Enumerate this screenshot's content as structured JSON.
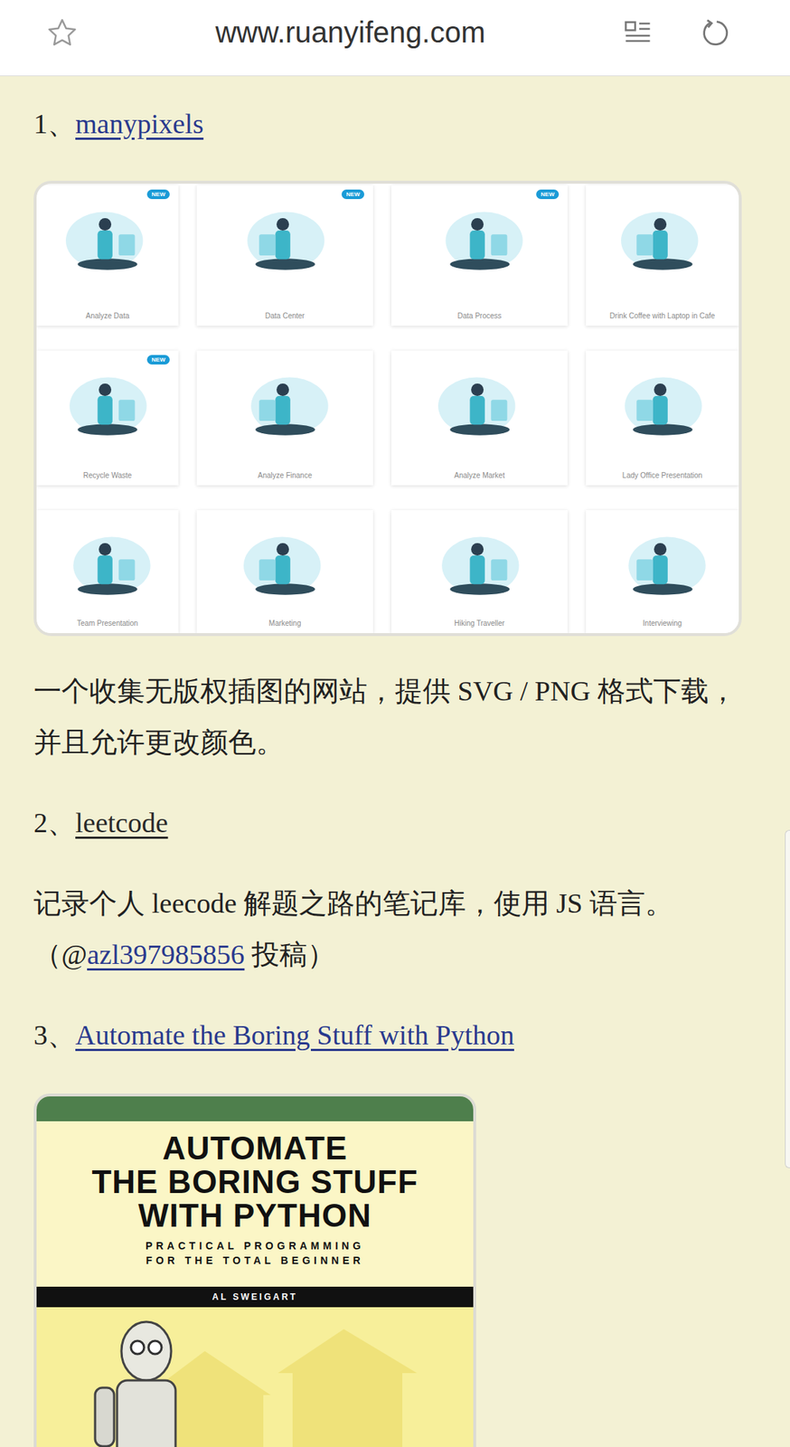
{
  "browser": {
    "url": "www.ruanyifeng.com",
    "bookmarked": false
  },
  "items": [
    {
      "number": "1、",
      "title": "manypixels",
      "visited": false,
      "kind": "gallery",
      "gallery": [
        {
          "label": "Analyze Data",
          "new": true,
          "badge": "NEW"
        },
        {
          "label": "Data Center",
          "new": true,
          "badge": "NEW"
        },
        {
          "label": "Data Process",
          "new": true,
          "badge": "NEW"
        },
        {
          "label": "Drink Coffee with Laptop in Cafe",
          "new": false,
          "badge": ""
        },
        {
          "label": "Recycle Waste",
          "new": true,
          "badge": "NEW"
        },
        {
          "label": "Analyze Finance",
          "new": false,
          "badge": ""
        },
        {
          "label": "Analyze Market",
          "new": false,
          "badge": ""
        },
        {
          "label": "Lady Office Presentation",
          "new": false,
          "badge": ""
        },
        {
          "label": "Team Presentation",
          "new": false,
          "badge": ""
        },
        {
          "label": "Marketing",
          "new": false,
          "badge": ""
        },
        {
          "label": "Hiking Traveller",
          "new": false,
          "badge": ""
        },
        {
          "label": "Interviewing",
          "new": false,
          "badge": ""
        }
      ],
      "description": [
        {
          "text": "一个收集无版权插图的网站，提供 SVG / PNG 格式下载，并且允许更改颜色。",
          "link": false
        }
      ]
    },
    {
      "number": "2、",
      "title": "leetcode",
      "visited": true,
      "kind": "text",
      "description": [
        {
          "text": "记录个人 leecode 解题之路的笔记库，使用 JS 语言。（@",
          "link": false
        },
        {
          "text": "azl397985856",
          "link": true
        },
        {
          "text": " 投稿）",
          "link": false
        }
      ]
    },
    {
      "number": "3、",
      "title": "Automate the Boring Stuff with Python",
      "visited": false,
      "kind": "book",
      "cover": {
        "title": [
          "AUTOMATE",
          "THE BORING STUFF",
          "WITH PYTHON"
        ],
        "subtitle": [
          "PRACTICAL PROGRAMMING",
          "FOR THE TOTAL BEGINNER"
        ],
        "author": "AL SWEIGART"
      }
    }
  ]
}
